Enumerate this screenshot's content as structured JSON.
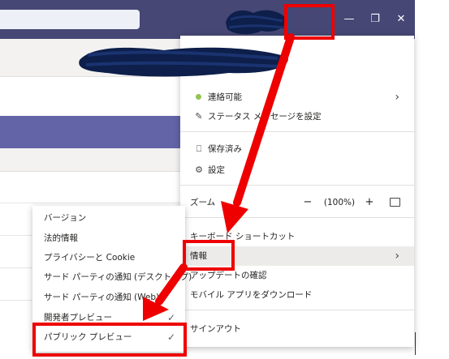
{
  "window": {
    "minimize_icon": "—",
    "restore_icon": "❐",
    "close_icon": "✕"
  },
  "menu": {
    "status_label": "連絡可能",
    "set_status_message": "ステータス メッセージを設定",
    "saved": "保存済み",
    "settings": "設定",
    "zoom_label": "ズーム",
    "zoom_minus": "−",
    "zoom_value": "(100%)",
    "zoom_plus": "+",
    "keyboard_shortcuts": "キーボード ショートカット",
    "info": "情報",
    "check_updates": "アップデートの確認",
    "download_mobile": "モバイル アプリをダウンロード",
    "sign_out": "サインアウト",
    "chevron": "›"
  },
  "submenu": {
    "items": [
      {
        "label": "バージョン"
      },
      {
        "label": "法的情報"
      },
      {
        "label": "プライバシーと Cookie"
      },
      {
        "label": "サード パーティの通知 (デスクトップ)"
      },
      {
        "label": "サード パーティの通知 (Web)"
      },
      {
        "label": "開発者プレビュー"
      },
      {
        "label": "パブリック プレビュー"
      }
    ],
    "check_glyph": "✓"
  },
  "colors": {
    "titlebar": "#464775",
    "accent_purple": "#6264a7",
    "status_green": "#92c353",
    "annotation_red": "#ee0000",
    "scribble_navy": "#0d1f4a"
  }
}
